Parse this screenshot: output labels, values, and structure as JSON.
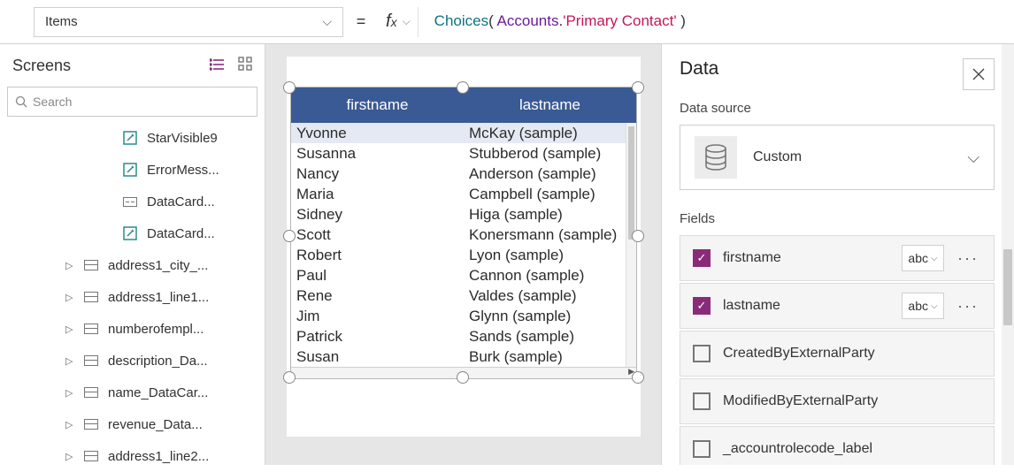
{
  "formula_bar": {
    "property": "Items",
    "fn": "Choices",
    "ident": "Accounts",
    "member": "'Primary Contact'"
  },
  "left": {
    "title": "Screens",
    "search_placeholder": "Search",
    "tree": [
      {
        "depth": 1,
        "icon": "edit",
        "label": "StarVisible9"
      },
      {
        "depth": 1,
        "icon": "edit",
        "label": "ErrorMess..."
      },
      {
        "depth": 1,
        "icon": "card",
        "label": "DataCard..."
      },
      {
        "depth": 1,
        "icon": "edit",
        "label": "DataCard..."
      },
      {
        "depth": 0,
        "icon": "group",
        "label": "address1_city_..."
      },
      {
        "depth": 0,
        "icon": "group",
        "label": "address1_line1..."
      },
      {
        "depth": 0,
        "icon": "group",
        "label": "numberofempl..."
      },
      {
        "depth": 0,
        "icon": "group",
        "label": "description_Da..."
      },
      {
        "depth": 0,
        "icon": "group",
        "label": "name_DataCar..."
      },
      {
        "depth": 0,
        "icon": "group",
        "label": "revenue_Data..."
      },
      {
        "depth": 0,
        "icon": "group",
        "label": "address1_line2..."
      }
    ]
  },
  "table": {
    "col1": "firstname",
    "col2": "lastname",
    "rows": [
      [
        "Yvonne",
        "McKay (sample)"
      ],
      [
        "Susanna",
        "Stubberod (sample)"
      ],
      [
        "Nancy",
        "Anderson (sample)"
      ],
      [
        "Maria",
        "Campbell (sample)"
      ],
      [
        "Sidney",
        "Higa (sample)"
      ],
      [
        "Scott",
        "Konersmann (sample)"
      ],
      [
        "Robert",
        "Lyon (sample)"
      ],
      [
        "Paul",
        "Cannon (sample)"
      ],
      [
        "Rene",
        "Valdes (sample)"
      ],
      [
        "Jim",
        "Glynn (sample)"
      ],
      [
        "Patrick",
        "Sands (sample)"
      ],
      [
        "Susan",
        "Burk (sample)"
      ]
    ]
  },
  "right": {
    "title": "Data",
    "ds_label": "Data source",
    "ds_name": "Custom",
    "fields_label": "Fields",
    "type_abc": "abc",
    "fields": [
      {
        "checked": true,
        "name": "firstname",
        "typed": true
      },
      {
        "checked": true,
        "name": "lastname",
        "typed": true
      },
      {
        "checked": false,
        "name": "CreatedByExternalParty",
        "typed": false
      },
      {
        "checked": false,
        "name": "ModifiedByExternalParty",
        "typed": false
      },
      {
        "checked": false,
        "name": "_accountrolecode_label",
        "typed": false
      }
    ]
  }
}
